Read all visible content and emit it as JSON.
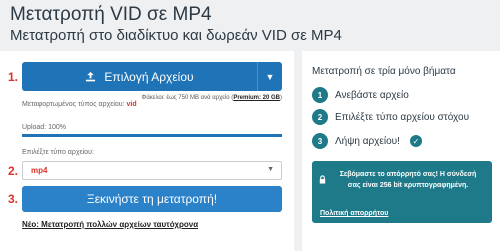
{
  "header": {
    "title": "Μετατροπή VID σε MP4",
    "subtitle": "Μετατροπή στο διαδίκτυο και δωρεάν VID σε MP4"
  },
  "steps": {
    "one": "1.",
    "two": "2.",
    "three": "3."
  },
  "upload": {
    "button_label": "Επιλογή Αρχείου",
    "limit_text": "Φάκελοι: έως 750 MB ανά αρχείο (",
    "limit_premium": "Premium: 20 GB",
    "limit_close": ")",
    "converted_label": "Μεταφορτωμένος τύπος αρχείου:",
    "converted_ext": "vid",
    "progress_label": "Upload: 100%",
    "progress_value": 1.0
  },
  "format": {
    "label": "Επιλέξτε τύπο αρχείου:",
    "selected": "mp4"
  },
  "actions": {
    "start_label": "Ξεκινήστε τη μετατροπή!",
    "multi_link": "Νέο: Μετατροπή πολλών αρχείων ταυτόχρονα"
  },
  "sidebar": {
    "title": "Μετατροπή σε τρία μόνο βήματα",
    "items": [
      {
        "num": "1",
        "label": "Ανεβάστε αρχείο"
      },
      {
        "num": "2",
        "label": "Επιλέξτε τύπο αρχείου στόχου"
      },
      {
        "num": "3",
        "label": "Λήψη αρχείου!"
      }
    ],
    "privacy_text": "Σεβόμαστε το απόρρητό σας! Η σύνδεσή σας είναι 256 bit κρυπτογραφημένη.",
    "privacy_link": "Πολιτική απορρήτου"
  },
  "colors": {
    "primary": "#1f73b7",
    "accent": "#d9342b",
    "teal": "#1e7a89"
  }
}
